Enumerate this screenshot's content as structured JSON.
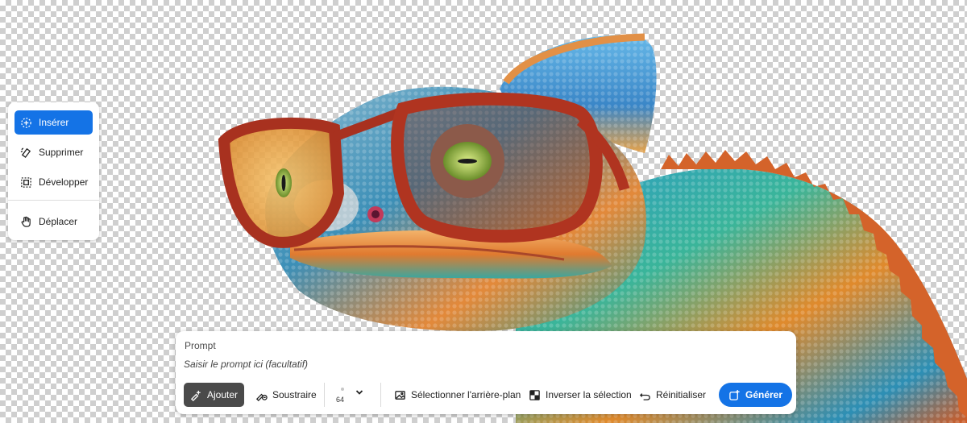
{
  "tools": {
    "items": [
      {
        "id": "insert",
        "label": "Insérer",
        "icon": "insert-sparkle-icon",
        "active": true
      },
      {
        "id": "remove",
        "label": "Supprimer",
        "icon": "eraser-icon",
        "active": false
      },
      {
        "id": "expand",
        "label": "Développer",
        "icon": "expand-frame-icon",
        "active": false
      }
    ],
    "move": {
      "id": "move",
      "label": "Déplacer",
      "icon": "hand-icon"
    }
  },
  "prompt": {
    "label": "Prompt",
    "placeholder": "Saisir le prompt ici (facultatif)",
    "value": ""
  },
  "toolbar": {
    "add_label": "Ajouter",
    "subtract_label": "Soustraire",
    "brush_size": "64",
    "select_background_label": "Sélectionner l'arrière-plan",
    "invert_selection_label": "Inverser la sélection",
    "reset_label": "Réinitialiser",
    "generate_label": "Générer"
  },
  "colors": {
    "accent": "#1473e6",
    "add_active": "#4a4a4a",
    "checker": "#cfcfcf"
  },
  "canvas": {
    "subject": "chameleon-with-red-glasses-image"
  }
}
